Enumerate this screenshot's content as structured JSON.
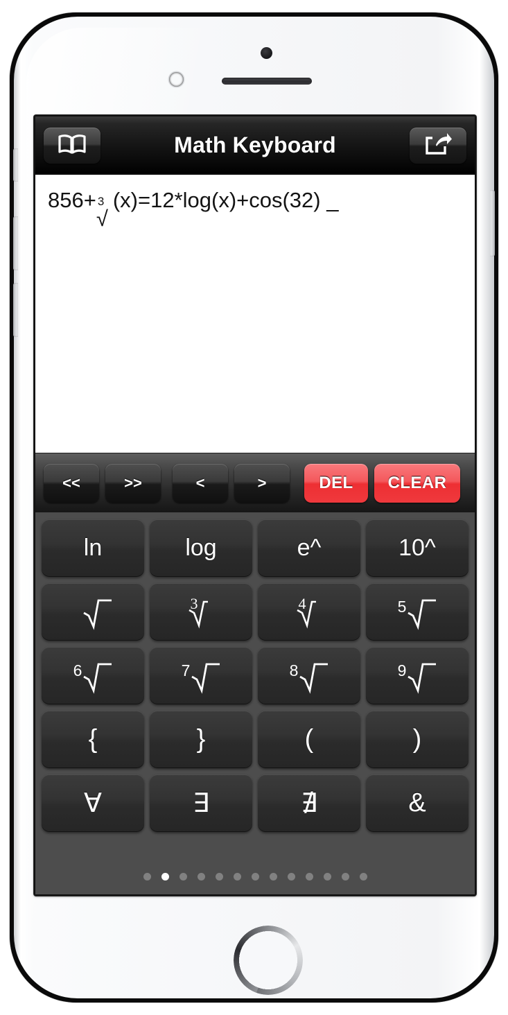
{
  "device": {
    "hardware": {
      "camera": "front-camera",
      "sensor": "proximity-sensor",
      "speaker": "earpiece-speaker",
      "home": "home-button",
      "silent_switch": "silent-switch",
      "volume_up": "volume-up-button",
      "volume_down": "volume-down-button",
      "power": "power-button"
    }
  },
  "navbar": {
    "title": "Math Keyboard",
    "left_button_icon": "book-icon",
    "right_button_icon": "share-icon"
  },
  "display": {
    "prefix": "856+",
    "radical_index": "3",
    "radical_glyph": "√",
    "suffix": "(x)=12*log(x)+cos(32)",
    "cursor": "_",
    "full_text": "856+∛(x)=12*log(x)+cos(32) _"
  },
  "toolbar": {
    "buttons": [
      {
        "label": "<<",
        "name": "word-left-button",
        "kind": "nav"
      },
      {
        "label": ">>",
        "name": "word-right-button",
        "kind": "nav"
      },
      {
        "label": "<",
        "name": "cursor-left-button",
        "kind": "nav"
      },
      {
        "label": ">",
        "name": "cursor-right-button",
        "kind": "nav"
      },
      {
        "label": "DEL",
        "name": "delete-button",
        "kind": "danger"
      },
      {
        "label": "CLEAR",
        "name": "clear-button",
        "kind": "danger"
      }
    ],
    "danger_color": "#ef3034"
  },
  "keypad": {
    "background": "#4d4d4d",
    "key_color": "#2f2f2f",
    "rows": [
      [
        {
          "label": "ln",
          "name": "key-ln",
          "type": "text"
        },
        {
          "label": "log",
          "name": "key-log",
          "type": "text"
        },
        {
          "label": "e^",
          "name": "key-e-pow",
          "type": "text"
        },
        {
          "label": "10^",
          "name": "key-10-pow",
          "type": "text"
        }
      ],
      [
        {
          "label": "√",
          "index": "",
          "name": "key-sqrt",
          "type": "radical"
        },
        {
          "label": "√",
          "index": "3",
          "name": "key-cbrt",
          "type": "radical-small"
        },
        {
          "label": "√",
          "index": "4",
          "name": "key-4th-root",
          "type": "radical-small"
        },
        {
          "label": "√",
          "index": "5",
          "name": "key-5th-root",
          "type": "radical"
        }
      ],
      [
        {
          "label": "√",
          "index": "6",
          "name": "key-6th-root",
          "type": "radical"
        },
        {
          "label": "√",
          "index": "7",
          "name": "key-7th-root",
          "type": "radical"
        },
        {
          "label": "√",
          "index": "8",
          "name": "key-8th-root",
          "type": "radical"
        },
        {
          "label": "√",
          "index": "9",
          "name": "key-9th-root",
          "type": "radical"
        }
      ],
      [
        {
          "label": "{",
          "name": "key-left-brace",
          "type": "text"
        },
        {
          "label": "}",
          "name": "key-right-brace",
          "type": "text"
        },
        {
          "label": "(",
          "name": "key-left-paren",
          "type": "text"
        },
        {
          "label": ")",
          "name": "key-right-paren",
          "type": "text"
        }
      ],
      [
        {
          "label": "∀",
          "name": "key-for-all",
          "type": "text"
        },
        {
          "label": "∃",
          "name": "key-exists",
          "type": "text"
        },
        {
          "label": "∄",
          "name": "key-not-exists",
          "type": "text"
        },
        {
          "label": "&",
          "name": "key-ampersand",
          "type": "text"
        }
      ]
    ],
    "page_dots": {
      "count": 13,
      "active_index": 1
    }
  }
}
